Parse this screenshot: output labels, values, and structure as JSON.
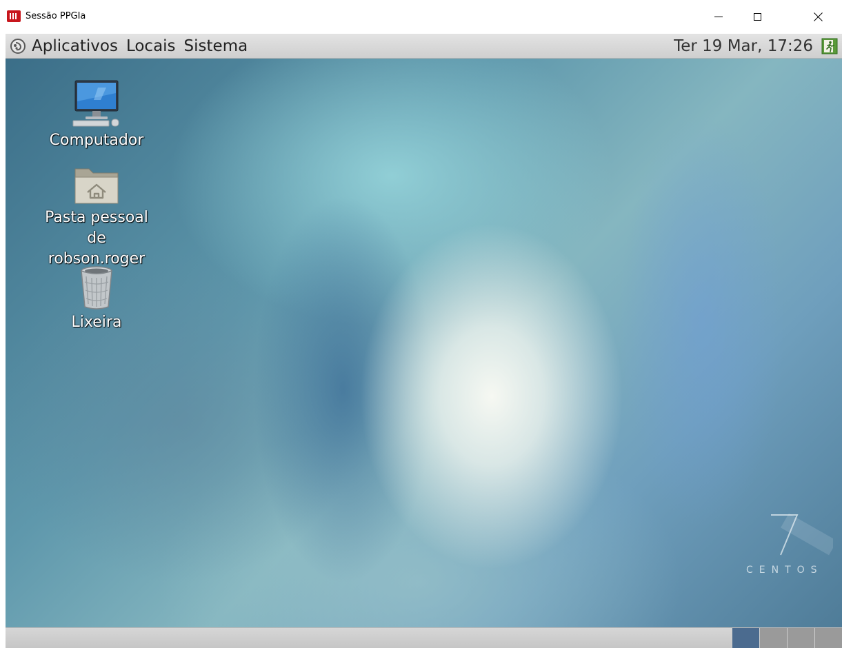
{
  "window": {
    "title": "Sessão PPGIa",
    "app_icon": "remote-session-icon",
    "controls": [
      "minimize",
      "maximize",
      "close"
    ]
  },
  "top_panel": {
    "menus": [
      {
        "label": "Aplicativos",
        "icon": "gnome-foot-icon"
      },
      {
        "label": "Locais"
      },
      {
        "label": "Sistema"
      }
    ],
    "clock": "Ter 19 Mar, 17:26",
    "logout_icon": "logout-icon"
  },
  "desktop": {
    "icons": [
      {
        "label": "Computador",
        "icon": "computer-icon"
      },
      {
        "label_line1": "Pasta pessoal",
        "label_line2": "de robson.roger",
        "icon": "home-folder-icon"
      },
      {
        "label": "Lixeira",
        "icon": "trash-icon"
      }
    ],
    "branding": {
      "number": "7",
      "text": "CENTOS"
    }
  },
  "bottom_panel": {
    "workspaces": [
      {
        "active": true
      },
      {
        "active": false
      },
      {
        "active": false
      },
      {
        "active": false
      }
    ],
    "active_color": "#4b6b8f"
  }
}
